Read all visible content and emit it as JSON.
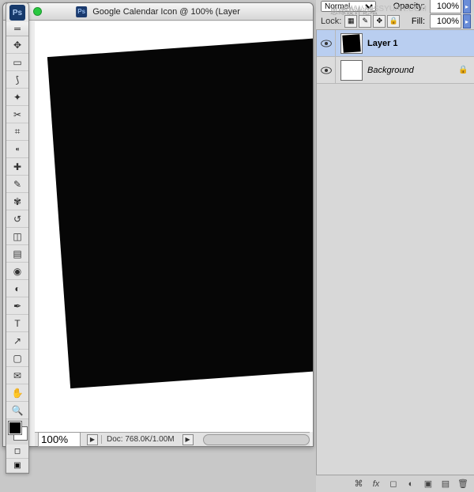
{
  "app": {
    "logo_text": "Ps"
  },
  "document": {
    "badge": "Ps",
    "title": "Google Calendar Icon @ 100% (Layer",
    "zoom": "100%",
    "doc_info": "Doc: 768.0K/1.00M"
  },
  "blend": {
    "mode": "Normal",
    "opacity_label": "Opacity:",
    "opacity_value": "100%"
  },
  "lock": {
    "label": "Lock:",
    "fill_label": "Fill:",
    "fill_value": "100%"
  },
  "layers": [
    {
      "name": "Layer 1",
      "visible": true,
      "selected": true,
      "locked": false,
      "thumb": "black"
    },
    {
      "name": "Background",
      "visible": true,
      "selected": false,
      "locked": true,
      "thumb": "white"
    }
  ],
  "tools": [
    "move",
    "marquee",
    "lasso",
    "wand",
    "crop",
    "slice",
    "eyedropper",
    "healing",
    "brush",
    "stamp",
    "history-brush",
    "eraser",
    "gradient",
    "blur",
    "dodge",
    "pen",
    "type",
    "path-select",
    "rectangle",
    "notes",
    "hand",
    "zoom"
  ],
  "watermark_cn": "思缘设计论坛",
  "watermark_url": "WWW.MISSYUAN.COM"
}
